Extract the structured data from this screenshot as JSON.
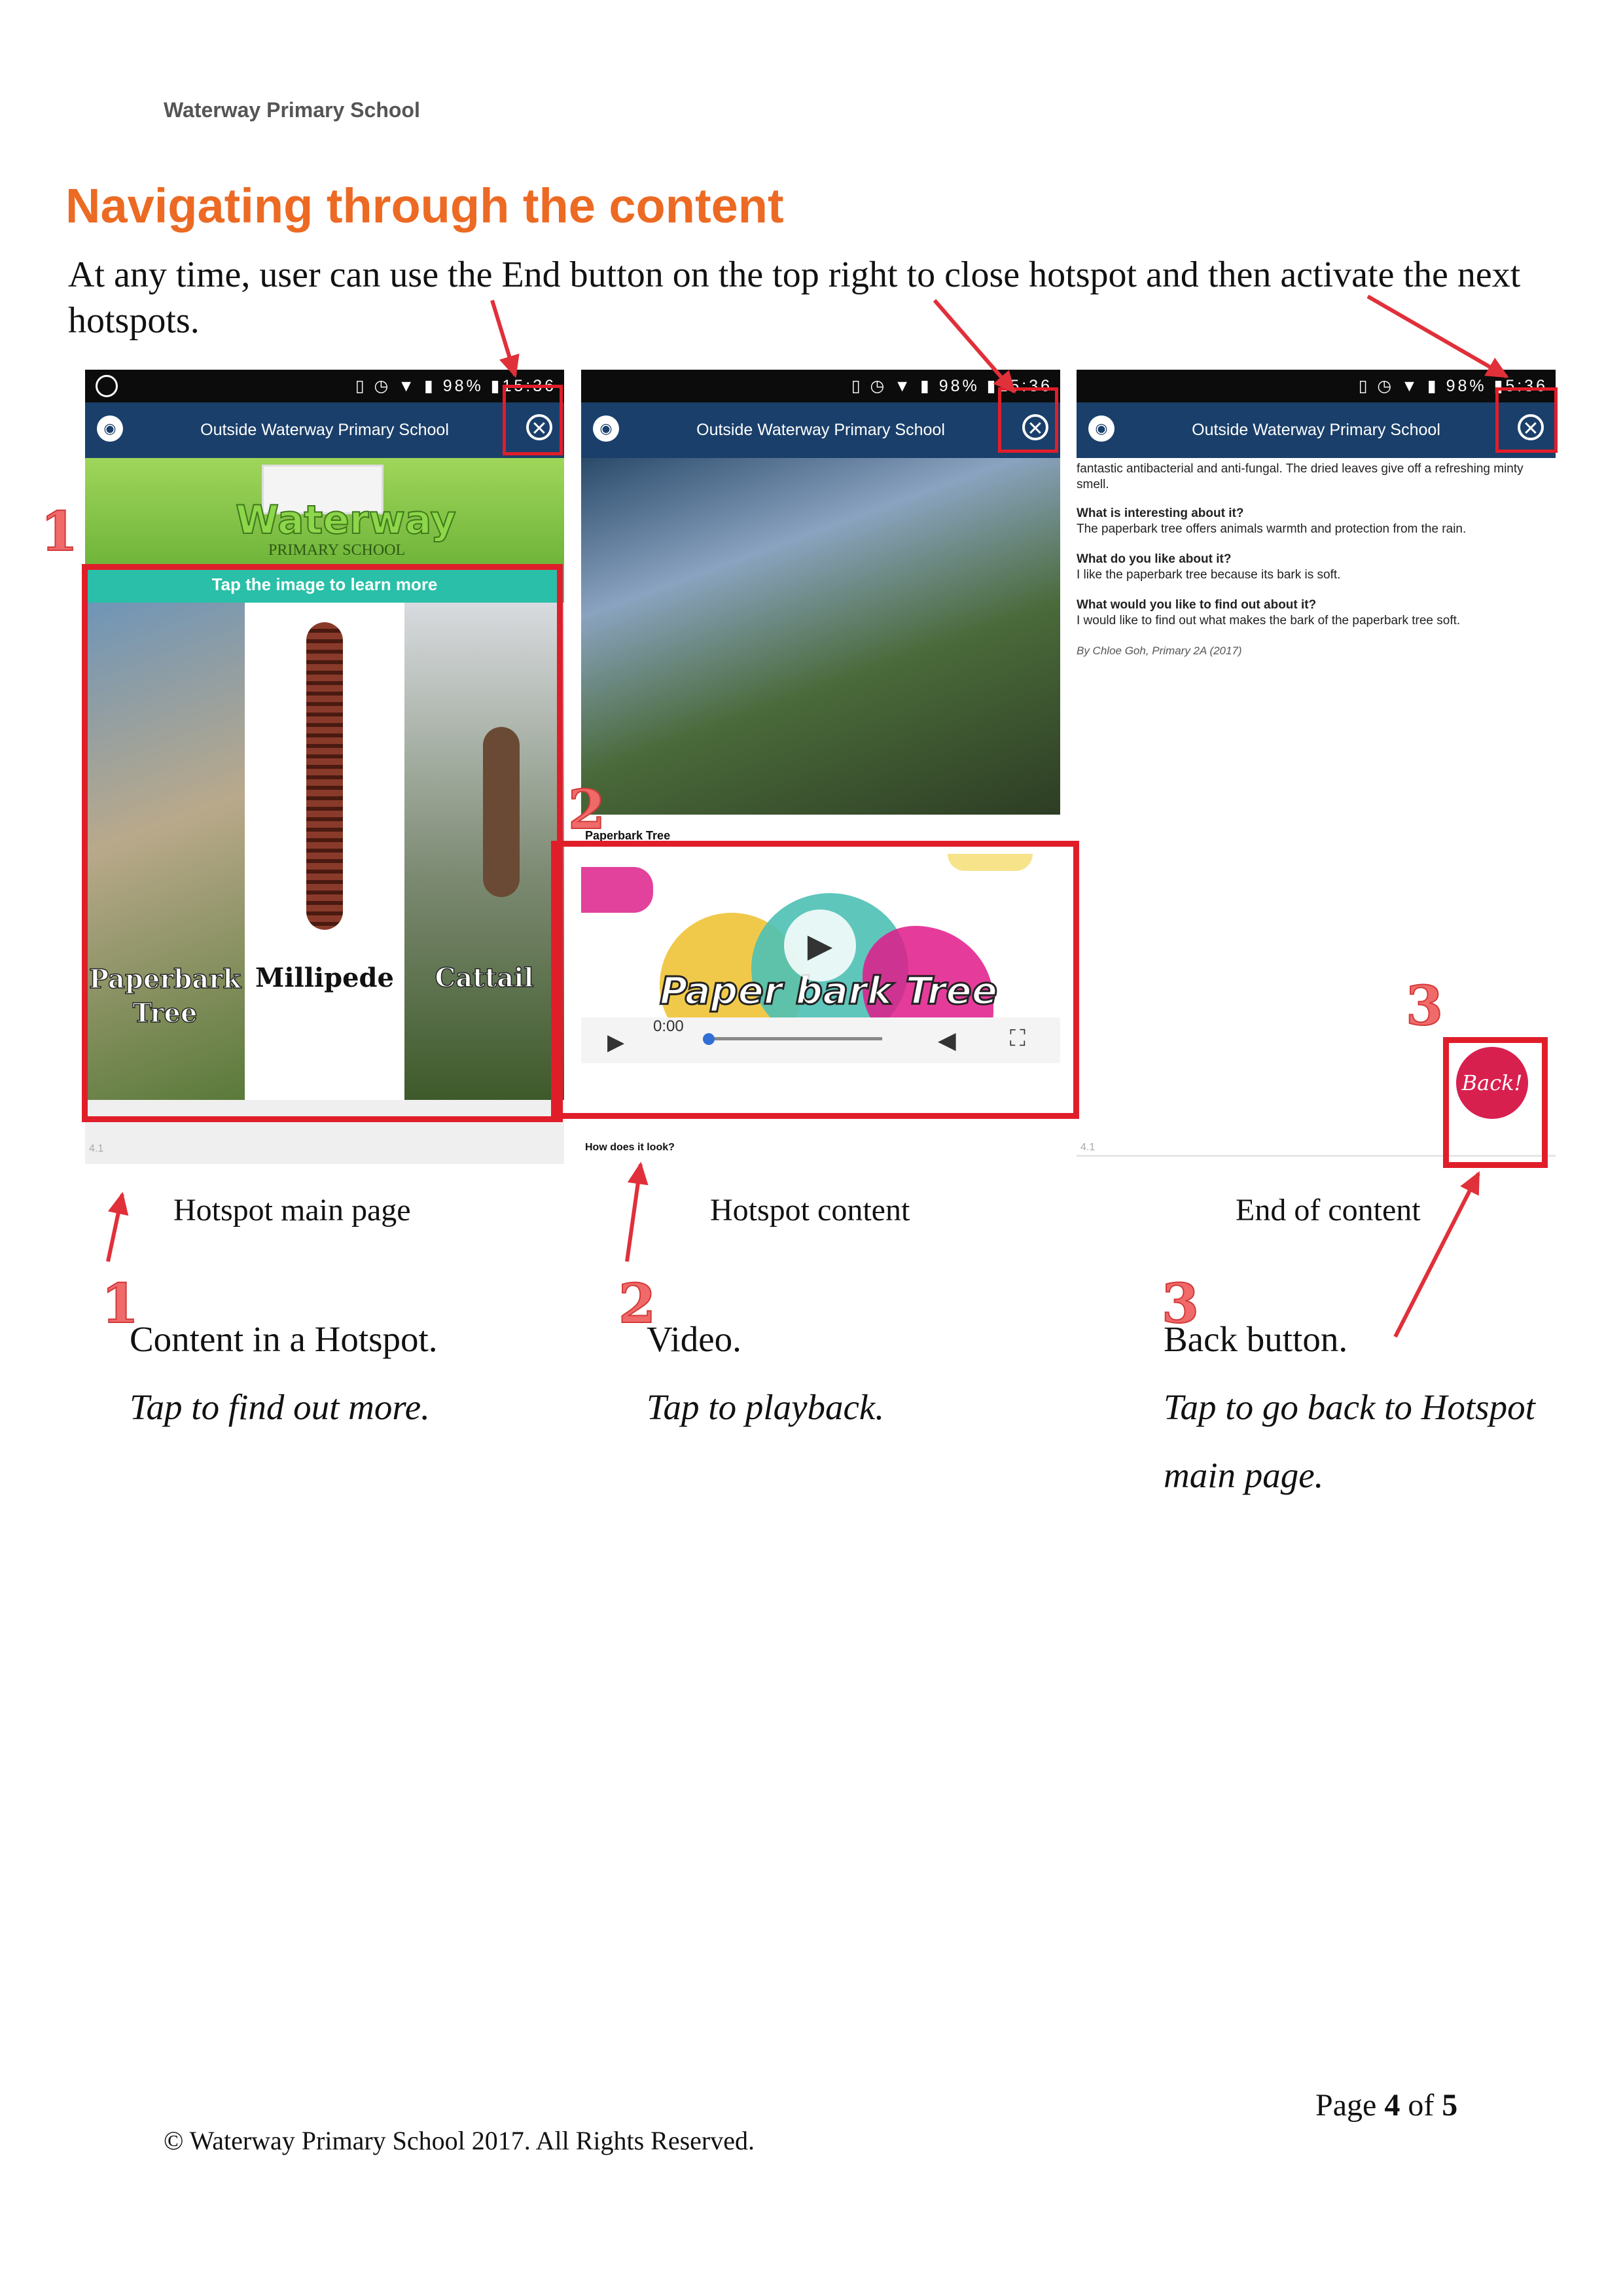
{
  "header": {
    "school": "Waterway Primary School"
  },
  "page_title": "Navigating through the content",
  "intro": "At any time, user can use the End button on the top right to close hotspot and then activate the next hotspots.",
  "status_bar": {
    "battery": "98%",
    "time": "15:36",
    "time_partial": "5:36"
  },
  "app_bar_title": "Outside Waterway Primary School",
  "phone1": {
    "banner_logo": "Waterway",
    "banner_sub": "PRIMARY SCHOOL",
    "tap_banner": "Tap the image to learn more",
    "tiles": [
      "Paperbark Tree",
      "Millipede",
      "Cattail"
    ],
    "page_marker": "4.1"
  },
  "phone2": {
    "section_label": "Paperbark Tree",
    "video_title": "Paper bark Tree",
    "video_time": "0:00",
    "question": "How does it look?"
  },
  "phone3": {
    "lead": "fantastic antibacterial and anti-fungal. The dried leaves give off a refreshing minty smell.",
    "qa": [
      {
        "q": "What is interesting about it?",
        "a": "The paperbark tree offers animals warmth and protection from the rain."
      },
      {
        "q": "What do you like about it?",
        "a": "I like the paperbark tree because its bark is soft."
      },
      {
        "q": "What would you like to find out about it?",
        "a": "I would like to find out what makes the bark of the paperbark tree soft."
      }
    ],
    "byline": "By Chloe Goh, Primary 2A (2017)",
    "back_label": "Back!",
    "page_marker": "4.1"
  },
  "captions": [
    "Hotspot main page",
    "Hotspot content",
    "End of content"
  ],
  "numbers": [
    "1",
    "2",
    "3"
  ],
  "descriptions": [
    {
      "title": "Content in a Hotspot.",
      "subtitle": "Tap to find out more."
    },
    {
      "title": "Video.",
      "subtitle": "Tap to playback."
    },
    {
      "title": "Back button.",
      "subtitle": "Tap to go back to Hotspot main page."
    }
  ],
  "footer": {
    "copyright": "© Waterway Primary School 2017. All Rights Reserved."
  },
  "pagination": {
    "prefix": "Page",
    "current": "4",
    "of": "of",
    "total": "5"
  },
  "colors": {
    "accent_orange": "#ec6a23",
    "highlight_red": "#e01e2a",
    "app_bar": "#1a3f6a",
    "teal_banner": "#29bfa8"
  }
}
